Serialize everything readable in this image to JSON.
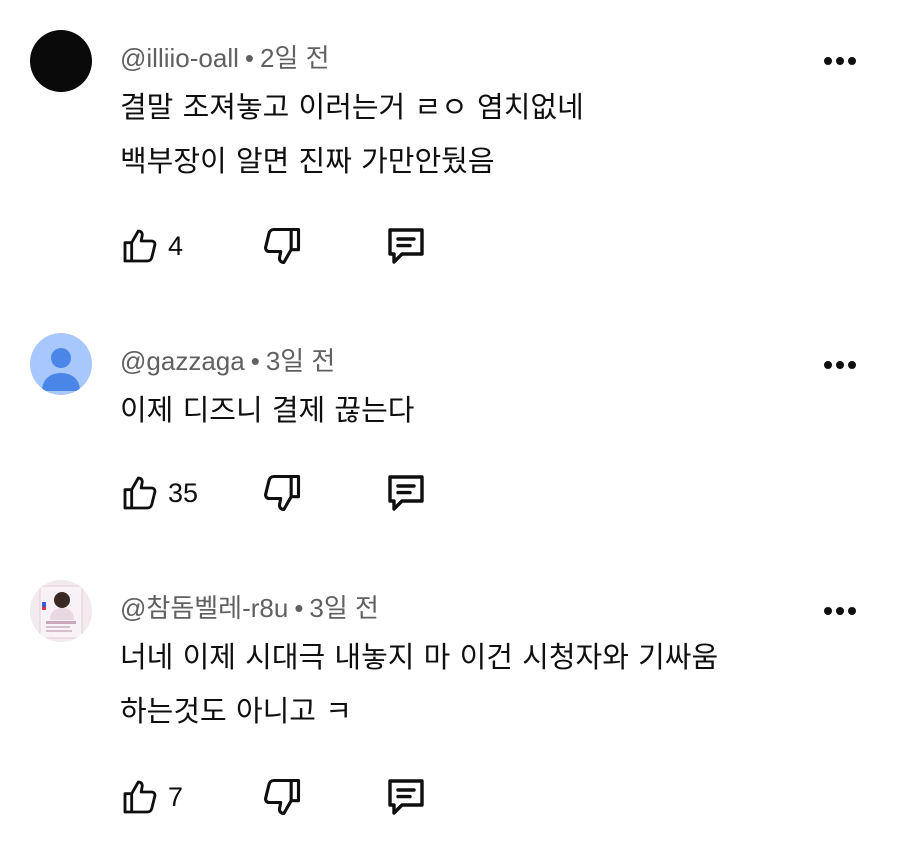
{
  "comments": [
    {
      "handle": "@illiio-oall",
      "time": "2일 전",
      "lines": [
        "결말 조져놓고 이러는거 ㄹㅇ 염치없네",
        "백부장이 알면 진짜 가만안뒀음"
      ],
      "likes": "4",
      "avatar": "dark"
    },
    {
      "handle": "@gazzaga",
      "time": "3일 전",
      "lines": [
        "이제 디즈니 결제  끊는다"
      ],
      "likes": "35",
      "avatar": "default-person"
    },
    {
      "handle": "@참돔벨레-r8u",
      "time": "3일 전",
      "lines": [
        "너네 이제 시대극 내놓지 마 이건 시청자와 기싸움",
        "하는것도 아니고 ㅋ"
      ],
      "likes": "7",
      "avatar": "photo"
    }
  ],
  "separator": "•",
  "colors": {
    "text": "#0f0f0f",
    "meta": "#606060",
    "default_avatar_bg": "#a8c7fa",
    "default_avatar_fg": "#4a86e8"
  },
  "icons": {
    "like": "thumbs-up-icon",
    "dislike": "thumbs-down-icon",
    "reply": "reply-comment-icon",
    "menu": "more-vertical-dots-icon"
  }
}
